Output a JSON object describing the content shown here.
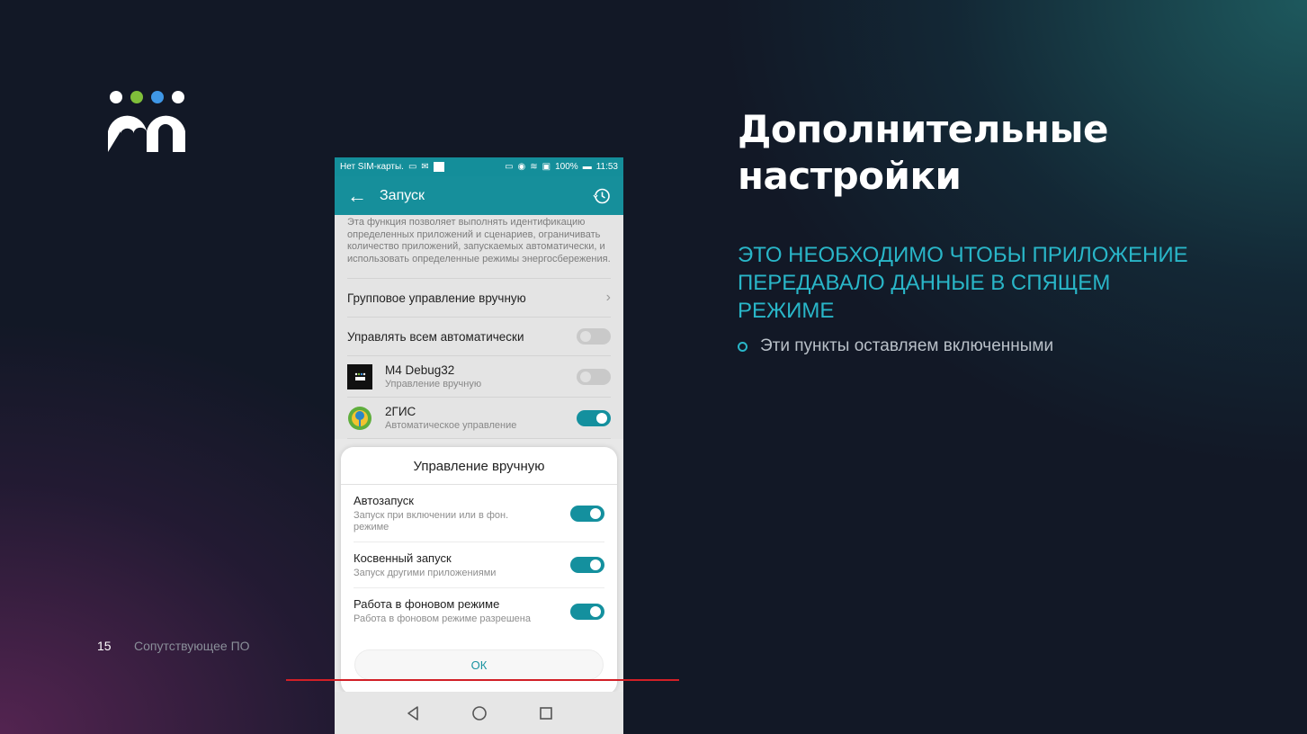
{
  "logo": {
    "name": "logo",
    "dot_colors": [
      "#ffffff",
      "#7fbf3a",
      "#3f97e6",
      "#ffffff"
    ]
  },
  "slide": {
    "title": "Дополнительные настройки",
    "subtitle": "Это необходимо чтобы приложение передавало данные в спящем режиме",
    "bullet": "Эти пункты оставляем включенными",
    "page_number": "15",
    "footer_text": "Сопутствующее ПО"
  },
  "phone": {
    "statusbar": {
      "carrier": "Нет SIM-карты.",
      "battery": "100%",
      "time": "11:53"
    },
    "appbar": {
      "title": "Запуск",
      "back_icon": "arrow-back-icon",
      "history_icon": "history-icon"
    },
    "description": "Эта функция позволяет выполнять идентификацию определенных приложений и сценариев, ограничивать количество приложений, запускаемых автоматически, и использовать определенные режимы энергосбережения.",
    "group_manual": "Групповое управление вручную",
    "auto_all": {
      "label": "Управлять всем автоматически",
      "on": false
    },
    "apps": [
      {
        "name": "M4 Debug32",
        "sub": "Управление вручную",
        "on": false
      },
      {
        "name": "2ГИС",
        "sub": "Автоматическое управление",
        "on": true
      }
    ],
    "dialog": {
      "title": "Управление вручную",
      "items": [
        {
          "name": "Автозапуск",
          "sub": "Запуск при включении или в фон. режиме",
          "on": true
        },
        {
          "name": "Косвенный запуск",
          "sub": "Запуск другими приложениями",
          "on": true
        },
        {
          "name": "Работа в фоновом режиме",
          "sub": "Работа в фоновом режиме разрешена",
          "on": true
        }
      ],
      "ok": "ОК"
    },
    "accent_color": "#14909e"
  },
  "colors": {
    "subtitle": "#29b6c8",
    "annotation_line": "#d21f26"
  }
}
